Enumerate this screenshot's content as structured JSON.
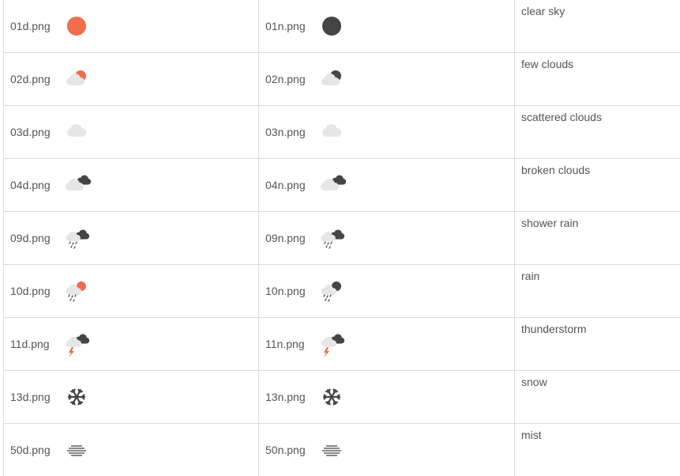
{
  "colors": {
    "sun": "#ee6e4d",
    "moon": "#454545",
    "cloud": "#e6e6e6",
    "dark_cloud": "#454545",
    "bolt": "#ee6e4d",
    "border": "#dcdcdc",
    "text": "#555555"
  },
  "rows": [
    {
      "day_file": "01d.png",
      "day_icon": "sun-icon",
      "night_file": "01n.png",
      "night_icon": "moon-icon",
      "description": "clear sky"
    },
    {
      "day_file": "02d.png",
      "day_icon": "few-clouds-day-icon",
      "night_file": "02n.png",
      "night_icon": "few-clouds-night-icon",
      "description": "few clouds"
    },
    {
      "day_file": "03d.png",
      "day_icon": "scattered-clouds-icon",
      "night_file": "03n.png",
      "night_icon": "scattered-clouds-icon",
      "description": "scattered clouds"
    },
    {
      "day_file": "04d.png",
      "day_icon": "broken-clouds-icon",
      "night_file": "04n.png",
      "night_icon": "broken-clouds-icon",
      "description": "broken clouds"
    },
    {
      "day_file": "09d.png",
      "day_icon": "shower-rain-icon",
      "night_file": "09n.png",
      "night_icon": "shower-rain-icon",
      "description": "shower rain"
    },
    {
      "day_file": "10d.png",
      "day_icon": "rain-day-icon",
      "night_file": "10n.png",
      "night_icon": "rain-night-icon",
      "description": "rain"
    },
    {
      "day_file": "11d.png",
      "day_icon": "thunderstorm-icon",
      "night_file": "11n.png",
      "night_icon": "thunderstorm-icon",
      "description": "thunderstorm"
    },
    {
      "day_file": "13d.png",
      "day_icon": "snowflake-icon",
      "night_file": "13n.png",
      "night_icon": "snowflake-icon",
      "description": "snow"
    },
    {
      "day_file": "50d.png",
      "day_icon": "mist-icon",
      "night_file": "50n.png",
      "night_icon": "mist-icon",
      "description": "mist"
    }
  ]
}
